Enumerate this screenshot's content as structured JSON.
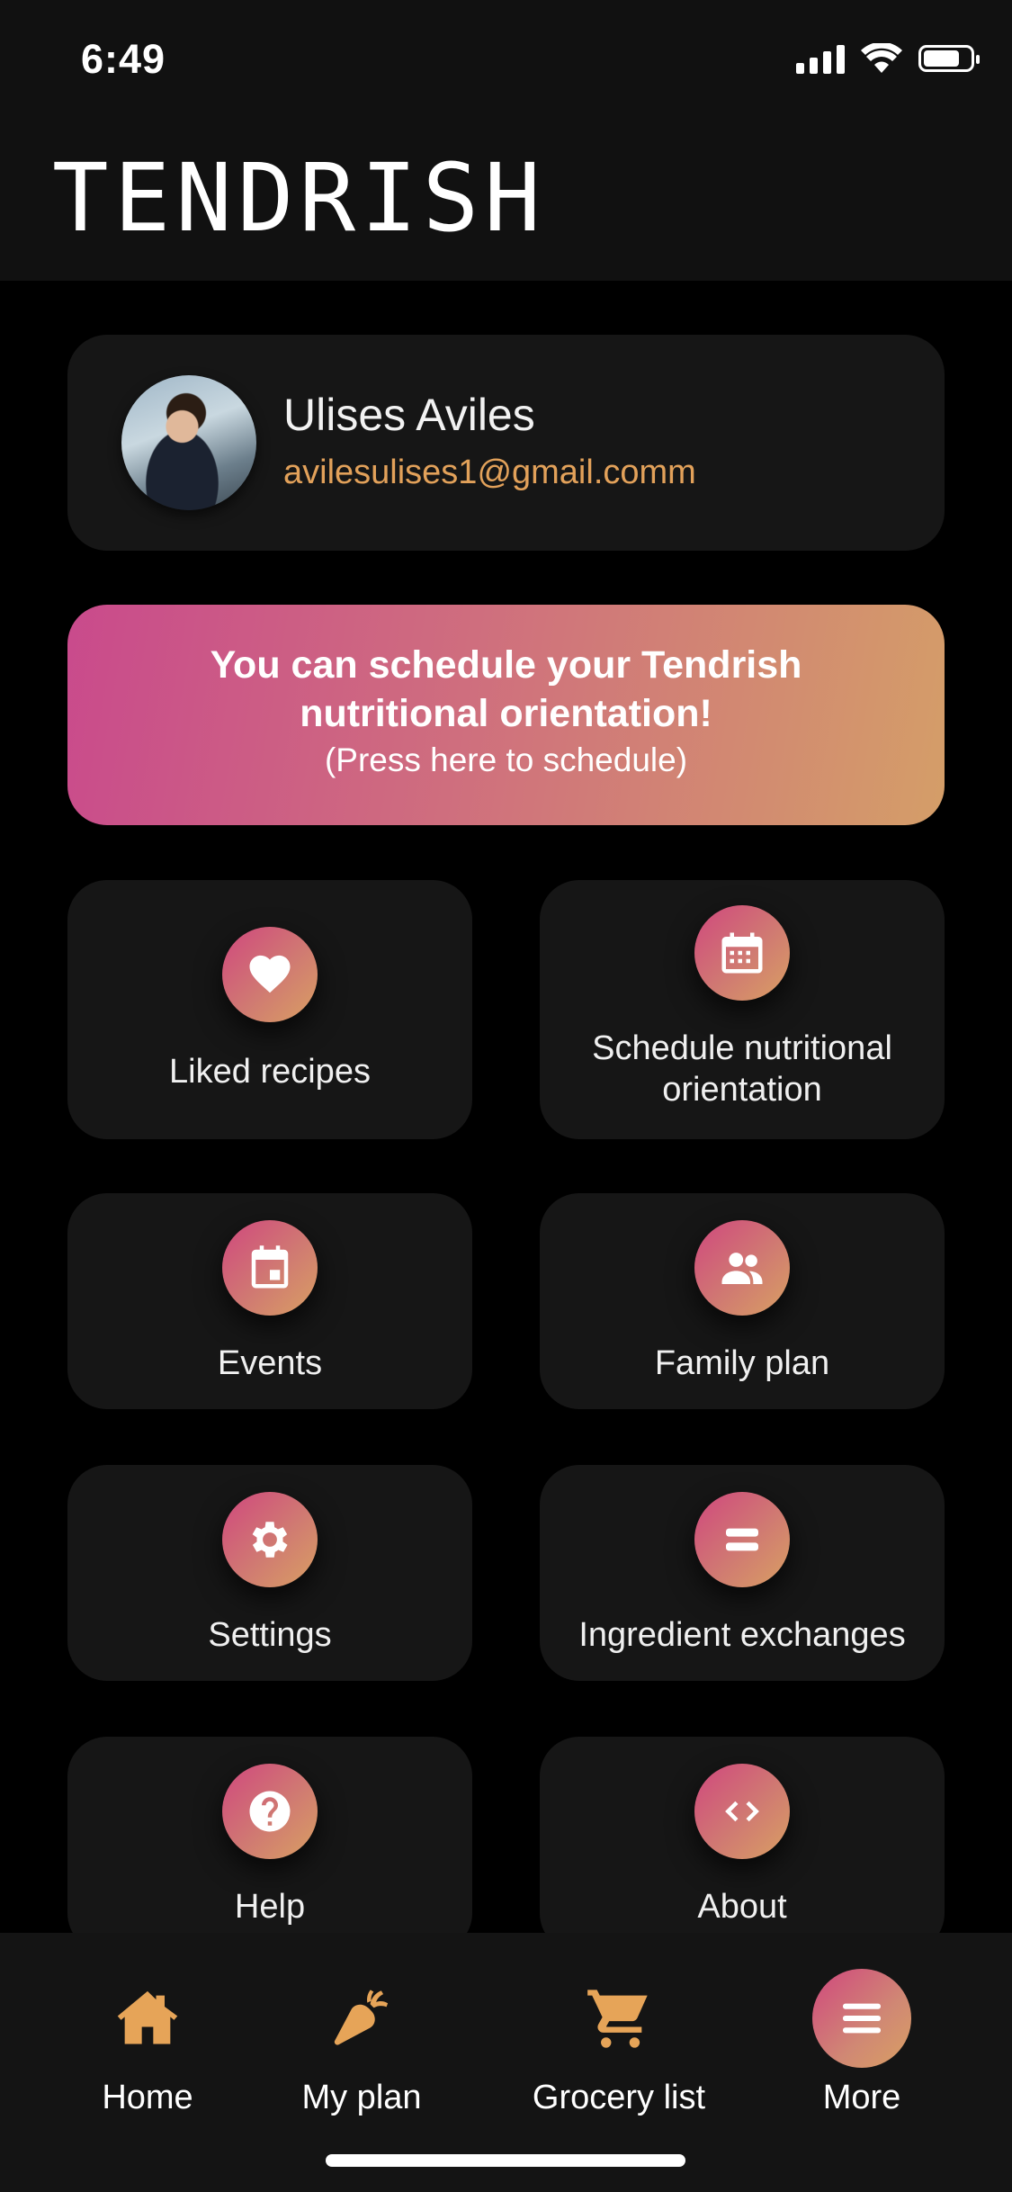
{
  "status_bar": {
    "time": "6:49"
  },
  "header": {
    "title": "TENDRISH"
  },
  "profile": {
    "name": "Ulises Aviles",
    "email": "avilesulises1@gmail.comm"
  },
  "banner": {
    "main": "You can schedule your Tendrish nutritional orientation!",
    "sub": "(Press here to schedule)",
    "gradient": [
      "#c94a8c",
      "#d49e68"
    ]
  },
  "menu": {
    "liked_recipes": "Liked recipes",
    "schedule": "Schedule nutritional orientation",
    "events": "Events",
    "family_plan": "Family plan",
    "settings": "Settings",
    "ingredient_exchanges": "Ingredient exchanges",
    "help": "Help",
    "about": "About"
  },
  "nav": {
    "home": "Home",
    "my_plan": "My plan",
    "grocery_list": "Grocery list",
    "more": "More"
  },
  "colors": {
    "accent": "#e6a458",
    "card": "#161616",
    "background": "#000000"
  }
}
